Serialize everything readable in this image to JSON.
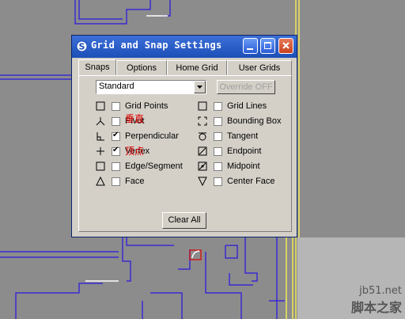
{
  "dialog": {
    "title": "Grid and Snap Settings"
  },
  "tabs": [
    {
      "label": "Snaps"
    },
    {
      "label": "Options"
    },
    {
      "label": "Home Grid"
    },
    {
      "label": "User Grids"
    }
  ],
  "preset_select": {
    "value": "Standard"
  },
  "override_button": {
    "label": "Override OFF"
  },
  "snaps_left": [
    {
      "label": "Grid Points",
      "checked": false,
      "icon": "grid-points-icon"
    },
    {
      "label": "Pivot",
      "checked": false,
      "icon": "pivot-icon",
      "overlay": "垂直"
    },
    {
      "label": "Perpendicular",
      "checked": true,
      "icon": "perpendicular-icon"
    },
    {
      "label": "Vertex",
      "checked": true,
      "icon": "vertex-icon",
      "overlay": "顶点"
    },
    {
      "label": "Edge/Segment",
      "checked": false,
      "icon": "edge-icon"
    },
    {
      "label": "Face",
      "checked": false,
      "icon": "face-icon"
    }
  ],
  "snaps_right": [
    {
      "label": "Grid Lines",
      "checked": false,
      "icon": "grid-lines-icon"
    },
    {
      "label": "Bounding Box",
      "checked": false,
      "icon": "bounding-box-icon"
    },
    {
      "label": "Tangent",
      "checked": false,
      "icon": "tangent-icon"
    },
    {
      "label": "Endpoint",
      "checked": false,
      "icon": "endpoint-icon"
    },
    {
      "label": "Midpoint",
      "checked": false,
      "icon": "midpoint-icon"
    },
    {
      "label": "Center Face",
      "checked": false,
      "icon": "center-face-icon"
    }
  ],
  "clear_all_button": {
    "label": "Clear All"
  },
  "watermark": {
    "line1": "jb51.net",
    "line2": "脚本之家"
  },
  "colors": {
    "viewport": "#8c8c8c",
    "wall": "#3b2bd0",
    "title_blue": "#2a5cd6",
    "annotation_red": "#e00000"
  }
}
